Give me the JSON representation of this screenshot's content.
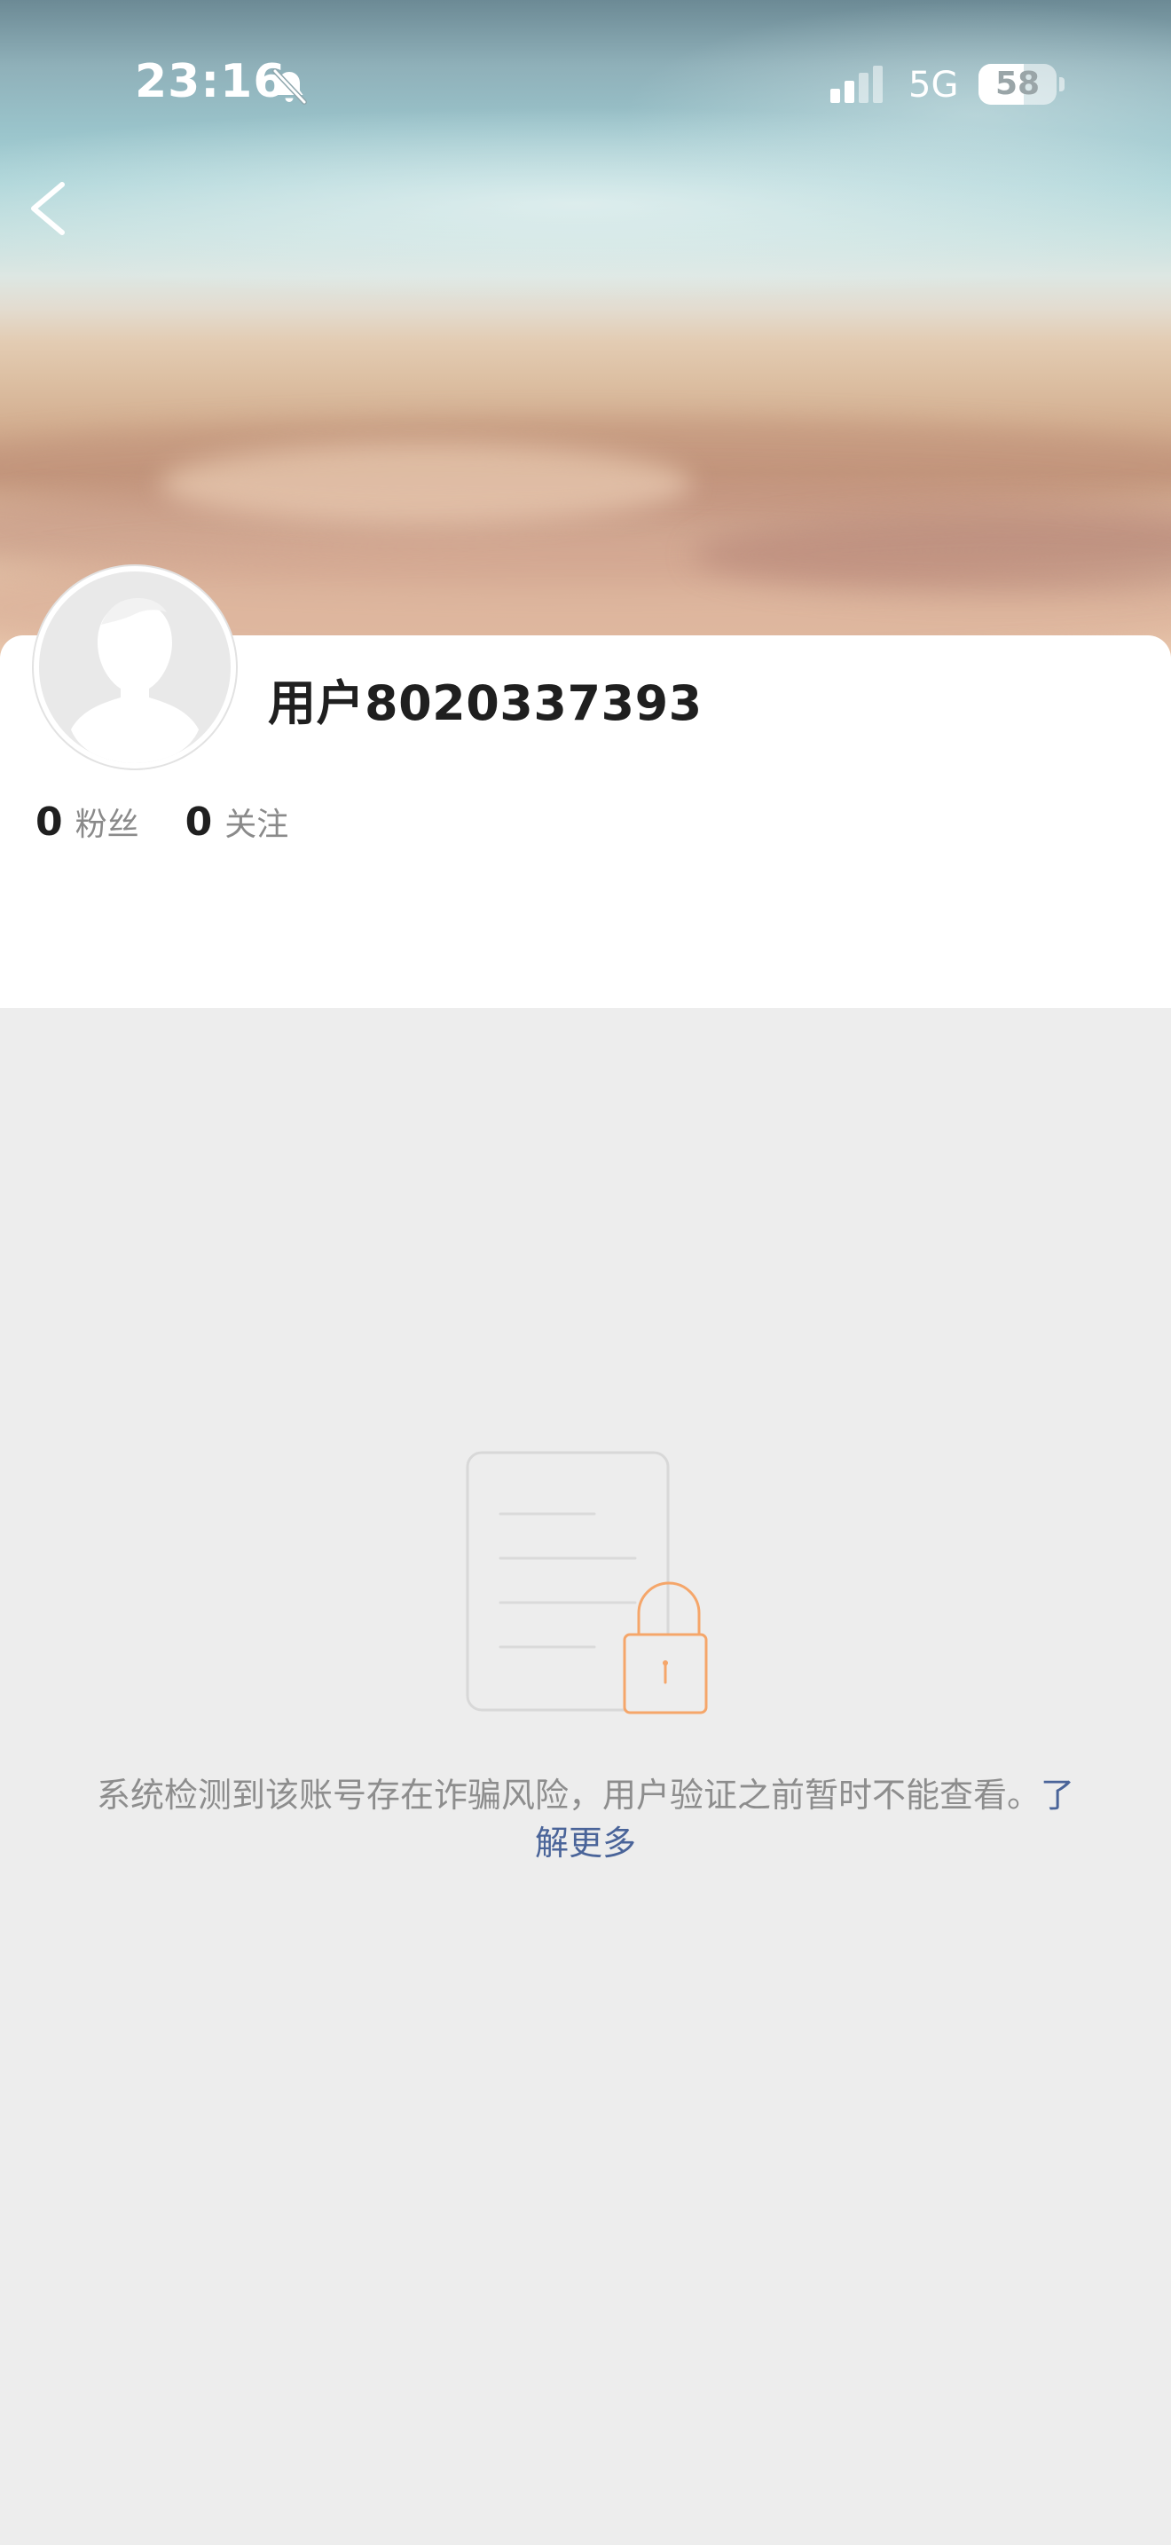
{
  "status_bar": {
    "time": "23:16",
    "mute_icon": "bell-slash-icon",
    "signal_icon": "signal-bars-icon",
    "network": "5G",
    "battery_level": "58",
    "battery_fraction": 0.58
  },
  "navigation": {
    "back_icon": "chevron-left-icon"
  },
  "profile": {
    "avatar_icon": "default-avatar-silhouette-icon",
    "username": "用户8020337393",
    "followers_count": "0",
    "followers_label": "粉丝",
    "following_count": "0",
    "following_label": "关注"
  },
  "locked_notice": {
    "illustration_icon": "locked-document-icon",
    "message": "系统检测到该账号存在诈骗风险，用户验证之前暂时不能查看。",
    "learn_more": "了解更多",
    "accent_color": "#f5a66a",
    "link_color": "#4a6499"
  }
}
